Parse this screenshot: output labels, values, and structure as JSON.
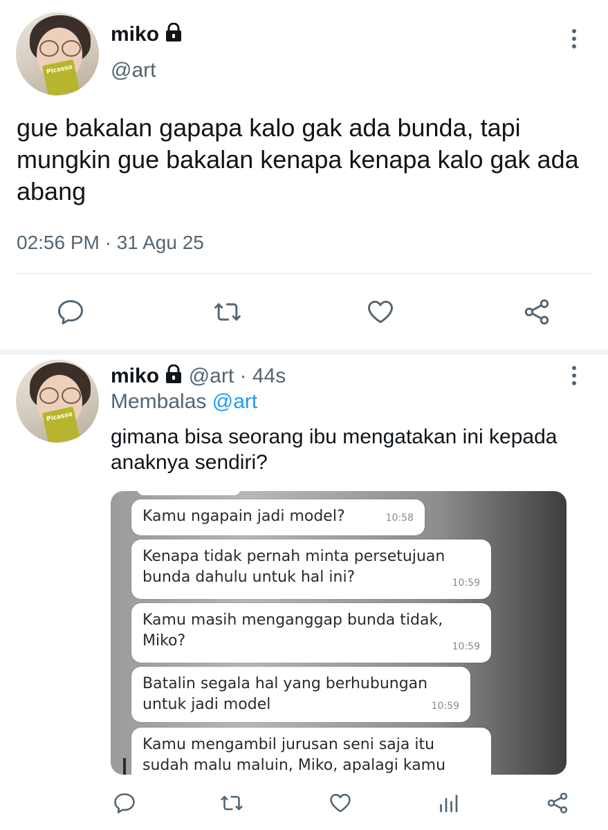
{
  "main_tweet": {
    "author_name": "miko",
    "author_handle": "@art",
    "text": "gue bakalan gapapa kalo gak ada bunda, tapi mungkin gue bakalan kenapa kenapa kalo gak ada abang",
    "timestamp": "02:56 PM · 31 Agu 25",
    "avatar_book_text": "Picasso",
    "actions": [
      "reply-icon",
      "retweet-icon",
      "like-icon",
      "share-icon"
    ]
  },
  "reply_tweet": {
    "author_name": "miko",
    "author_handle": "@art",
    "time_ago": "· 44s",
    "replying_to_prefix": "Membalas",
    "replying_to_handle": "@art",
    "text": "gimana bisa seorang ibu mengatakan ini kepada anaknya sendiri?",
    "avatar_book_text": "Picasso",
    "actions": [
      "reply-icon",
      "retweet-icon",
      "like-icon",
      "analytics-icon",
      "share-icon"
    ]
  },
  "chat_screenshot": {
    "messages": [
      {
        "text": "Kamu ngapain jadi model?",
        "time": "10:58"
      },
      {
        "text": "Kenapa tidak pernah minta persetujuan bunda dahulu untuk hal ini?",
        "time": "10:59"
      },
      {
        "text": "Kamu masih menganggap bunda tidak, Miko?",
        "time": "10:59"
      },
      {
        "text": "Batalin segala hal yang berhubungan untuk jadi model",
        "time": "10:59"
      },
      {
        "text": "Kamu mengambil jurusan seni saja itu sudah malu maluin, Miko, apalagi kamu",
        "time": ""
      }
    ]
  },
  "colors": {
    "text_primary": "#0f1419",
    "text_secondary": "#536471",
    "link": "#1d9bf0",
    "divider": "#dfe3e6",
    "icon": "#536471"
  }
}
